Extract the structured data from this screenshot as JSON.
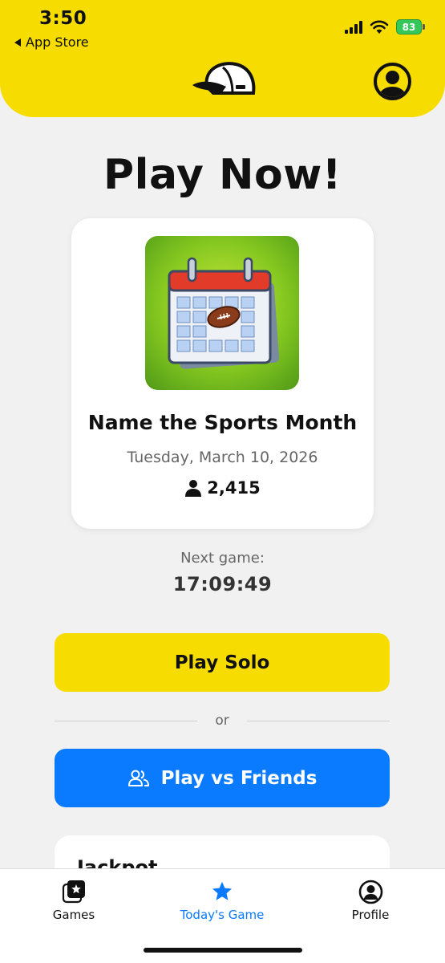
{
  "status_bar": {
    "time": "3:50",
    "back_label": "App Store",
    "battery": "83"
  },
  "header": {
    "logo_icon": "cap-logo-icon",
    "profile_icon": "user-circle-icon"
  },
  "page": {
    "title": "Play Now!"
  },
  "game_card": {
    "image_icon": "calendar-football-icon",
    "title": "Name the Sports Month",
    "date": "Tuesday, March 10, 2026",
    "player_count": "2,415"
  },
  "next_game": {
    "label": "Next game:",
    "countdown": "17:09:49"
  },
  "actions": {
    "solo_label": "Play Solo",
    "divider_label": "or",
    "friends_label": "Play vs Friends"
  },
  "jackpot": {
    "title": "Jackpot"
  },
  "tabbar": {
    "items": [
      {
        "label": "Games",
        "icon": "games-star-icon"
      },
      {
        "label": "Today's Game",
        "icon": "star-icon",
        "active": true
      },
      {
        "label": "Profile",
        "icon": "user-circle-icon"
      }
    ]
  },
  "colors": {
    "brand_yellow": "#f7dc00",
    "accent_blue": "#0a7aff",
    "battery_green": "#34c759"
  }
}
